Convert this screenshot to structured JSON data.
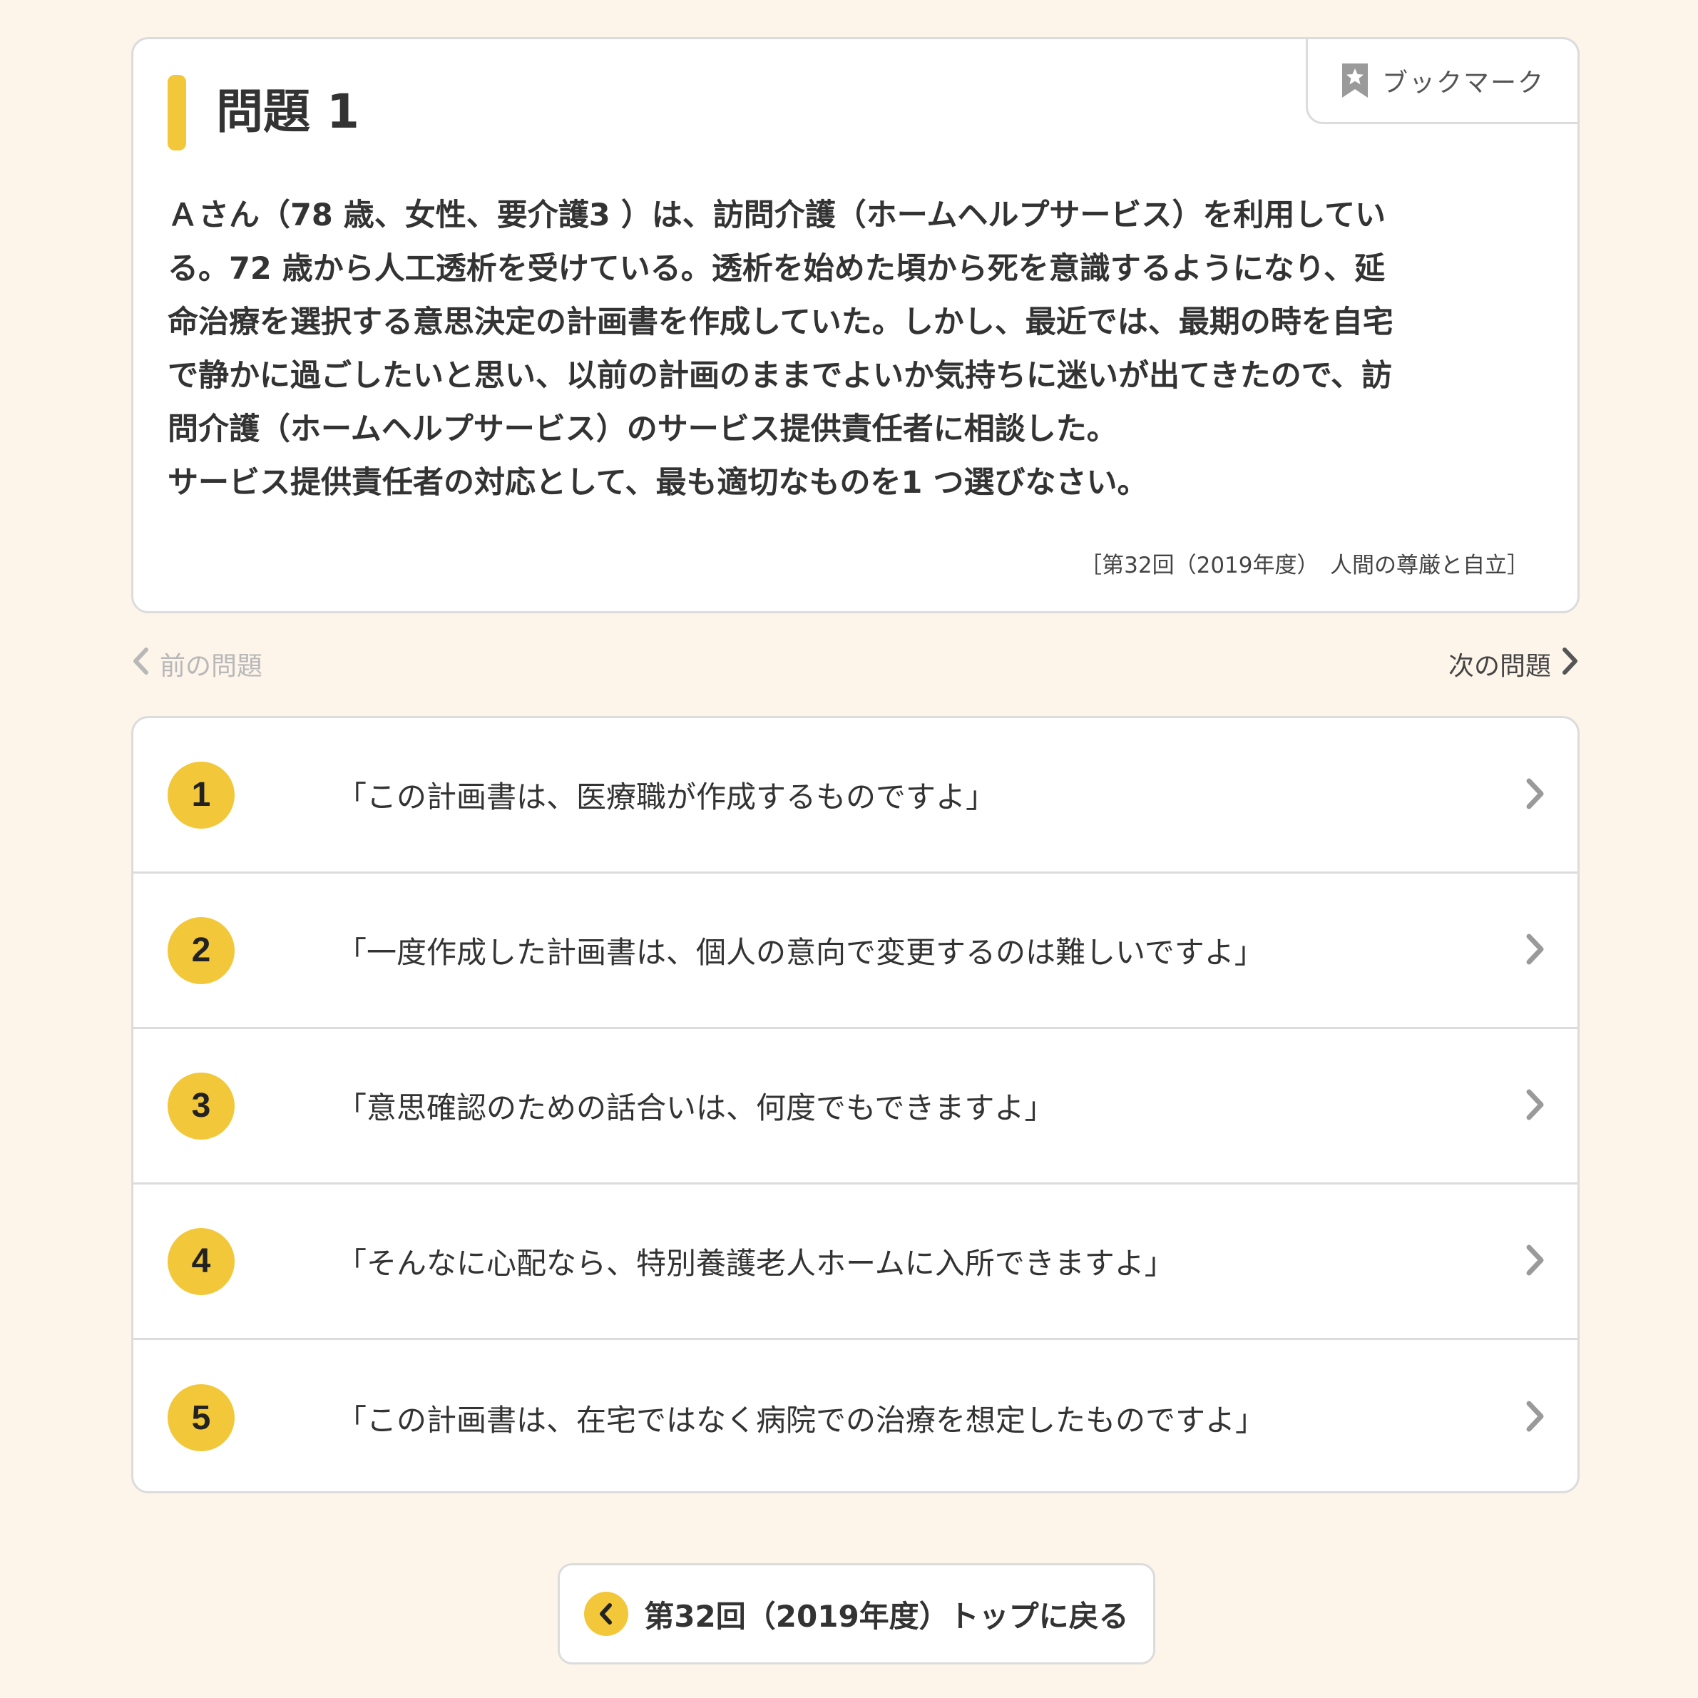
{
  "question": {
    "title": "問題 1",
    "bookmark_label": "ブックマーク",
    "body": "Ａさん（78 歳、女性、要介護3 ）は、訪問介護（ホームヘルプサービス）を利用してい\nる。72 歳から人工透析を受けている。透析を始めた頃から死を意識するようになり、延\n命治療を選択する意思決定の計画書を作成していた。しかし、最近では、最期の時を自宅\nで静かに過ごしたいと思い、以前の計画のままでよいか気持ちに迷いが出てきたので、訪\n問介護（ホームヘルプサービス）のサービス提供責任者に相談した。\nサービス提供責任者の対応として、最も適切なものを1 つ選びなさい。",
    "source": "［第32回（2019年度）　人間の尊厳と自立］"
  },
  "nav": {
    "prev_label": "前の問題",
    "next_label": "次の問題"
  },
  "choices": [
    {
      "number": "1",
      "text": "「この計画書は、医療職が作成するものですよ」"
    },
    {
      "number": "2",
      "text": "「一度作成した計画書は、個人の意向で変更するのは難しいですよ」"
    },
    {
      "number": "3",
      "text": "「意思確認のための話合いは、何度でもできますよ」"
    },
    {
      "number": "4",
      "text": "「そんなに心配なら、特別養護老人ホームに入所できますよ」"
    },
    {
      "number": "5",
      "text": "「この計画書は、在宅ではなく病院での治療を想定したものですよ」"
    }
  ],
  "back_button": {
    "label": "第32回（2019年度）トップに戻る"
  },
  "colors": {
    "background": "#fdf4ea",
    "accent": "#f2c83a",
    "border": "#dcdcdc",
    "text": "#333333",
    "muted": "#b8b8b8"
  },
  "icons": {
    "bookmark": "bookmark-star-icon",
    "prev": "chevron-left-icon",
    "next": "chevron-right-icon",
    "choice_arrow": "chevron-right-icon",
    "back": "chevron-left-circle-icon"
  }
}
